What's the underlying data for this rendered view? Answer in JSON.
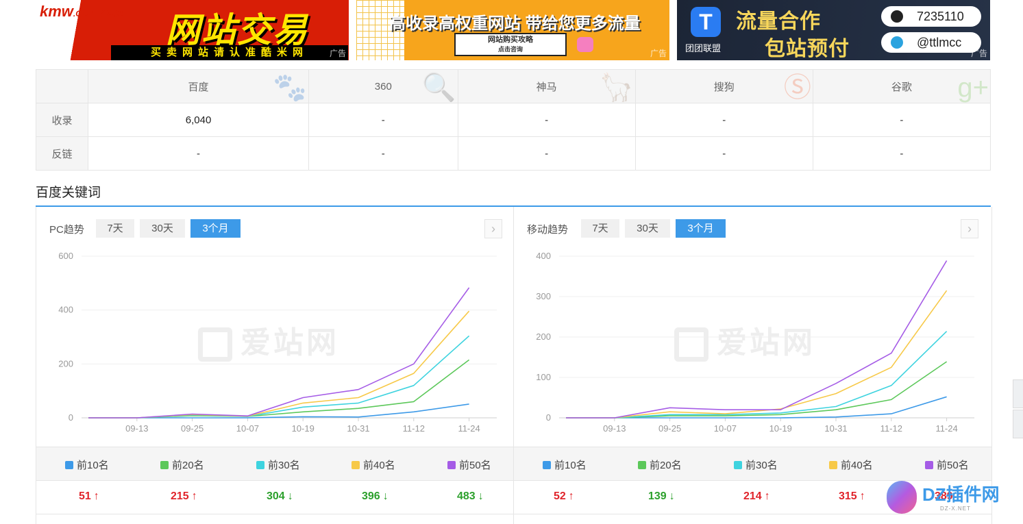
{
  "ads": {
    "ad1": {
      "logo": "kmw",
      "logo_domain": ".COM",
      "logo_cn": "酷米网",
      "headline": "网站交易",
      "slogan": "买卖网站请认准酷米网",
      "tag": "广告"
    },
    "ad2": {
      "headline": "高收录高权重网站  带给您更多流量",
      "button_line1": "网站购买攻略",
      "button_line2": "点击咨询",
      "tag": "广告"
    },
    "ad3": {
      "brand": "团团联盟",
      "line1": "流量合作",
      "line2": "包站预付",
      "qq": "7235110",
      "telegram": "@ttlmcc",
      "tag": "广告"
    }
  },
  "engine_table": {
    "columns": [
      "百度",
      "360",
      "神马",
      "搜狗",
      "谷歌"
    ],
    "rows": [
      {
        "label": "收录",
        "values": [
          "6,040",
          "-",
          "-",
          "-",
          "-"
        ]
      },
      {
        "label": "反链",
        "values": [
          "-",
          "-",
          "-",
          "-",
          "-"
        ]
      }
    ]
  },
  "section_title": "百度关键词",
  "watermark": "爱站网",
  "colors": {
    "accent": "#3d9ae8",
    "top10": "#3d9ae8",
    "top20": "#5cc85a",
    "top30": "#3ed3df",
    "top40": "#f7c948",
    "top50": "#a55ce6",
    "up": "#e0242b",
    "down": "#2ca02c"
  },
  "pc": {
    "title": "PC趋势",
    "tabs": [
      "7天",
      "30天",
      "3个月"
    ],
    "active_tab": 2,
    "legend": [
      "前10名",
      "前20名",
      "前30名",
      "前40名",
      "前50名"
    ],
    "values": [
      {
        "value": "51",
        "trend": "up"
      },
      {
        "value": "215",
        "trend": "up"
      },
      {
        "value": "304",
        "trend": "down"
      },
      {
        "value": "396",
        "trend": "down"
      },
      {
        "value": "483",
        "trend": "down"
      }
    ]
  },
  "mobile": {
    "title": "移动趋势",
    "tabs": [
      "7天",
      "30天",
      "3个月"
    ],
    "active_tab": 2,
    "legend": [
      "前10名",
      "前20名",
      "前30名",
      "前40名",
      "前50名"
    ],
    "values": [
      {
        "value": "52",
        "trend": "up"
      },
      {
        "value": "139",
        "trend": "down"
      },
      {
        "value": "214",
        "trend": "up"
      },
      {
        "value": "315",
        "trend": "up"
      },
      {
        "value": "389",
        "trend": "up"
      }
    ]
  },
  "dz_logo": {
    "name": "DZ插件网",
    "domain": "DZ-X.NET"
  },
  "chart_data": [
    {
      "type": "line",
      "title": "PC趋势",
      "x": [
        "09-13",
        "09-25",
        "10-07",
        "10-19",
        "10-31",
        "11-12",
        "11-24"
      ],
      "ylim": [
        0,
        600
      ],
      "yticks": [
        0,
        200,
        400,
        600
      ],
      "grid": true,
      "legend_position": "bottom",
      "series": [
        {
          "name": "前10名",
          "values": [
            0,
            0,
            0,
            4,
            3,
            22,
            51
          ]
        },
        {
          "name": "前20名",
          "values": [
            0,
            8,
            5,
            22,
            35,
            60,
            215
          ]
        },
        {
          "name": "前30名",
          "values": [
            0,
            10,
            5,
            40,
            55,
            120,
            304
          ]
        },
        {
          "name": "前40名",
          "values": [
            0,
            12,
            6,
            55,
            75,
            165,
            396
          ]
        },
        {
          "name": "前50名",
          "values": [
            0,
            14,
            7,
            75,
            105,
            200,
            483
          ]
        }
      ]
    },
    {
      "type": "line",
      "title": "移动趋势",
      "x": [
        "09-13",
        "09-25",
        "10-07",
        "10-19",
        "10-31",
        "11-12",
        "11-24"
      ],
      "ylim": [
        0,
        400
      ],
      "yticks": [
        0,
        100,
        200,
        300,
        400
      ],
      "grid": true,
      "legend_position": "bottom",
      "series": [
        {
          "name": "前10名",
          "values": [
            0,
            0,
            0,
            0,
            2,
            10,
            52
          ]
        },
        {
          "name": "前20名",
          "values": [
            0,
            5,
            5,
            8,
            20,
            45,
            139
          ]
        },
        {
          "name": "前30名",
          "values": [
            0,
            8,
            8,
            12,
            28,
            80,
            214
          ]
        },
        {
          "name": "前40名",
          "values": [
            0,
            15,
            10,
            22,
            60,
            125,
            315
          ]
        },
        {
          "name": "前50名",
          "values": [
            0,
            25,
            20,
            20,
            85,
            160,
            389
          ]
        }
      ]
    }
  ]
}
